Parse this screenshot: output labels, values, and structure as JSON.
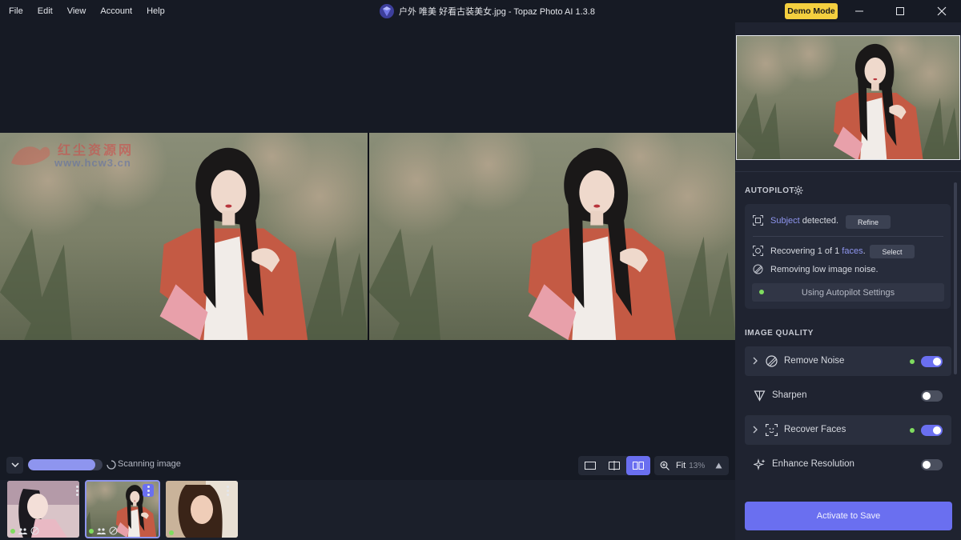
{
  "menu": [
    "File",
    "Edit",
    "View",
    "Account",
    "Help"
  ],
  "window": {
    "title": "户外 唯美 好看古装美女.jpg - Topaz Photo AI 1.3.8",
    "demo_badge": "Demo Mode",
    "controls": [
      "minimize-icon",
      "maximize-icon",
      "close-icon"
    ]
  },
  "watermark": {
    "line1": "红尘资源网",
    "line2": "www.hcw3.cn"
  },
  "bottombar": {
    "progress": 0.9,
    "status": "Scanning image",
    "views": [
      "single-view-icon",
      "split-view-icon",
      "side-by-side-icon"
    ],
    "active_view": 2,
    "zoom_label": "Fit",
    "zoom_value": "13%"
  },
  "thumbnails": {
    "selected": 1,
    "count": 3
  },
  "autopilot": {
    "title": "AUTOPILOT",
    "subject_prefix": "",
    "subject_word": "Subject",
    "subject_suffix": "detected.",
    "refine_label": "Refine",
    "faces_prefix": "Recovering 1 of 1",
    "faces_word": "faces",
    "faces_suffix": ".",
    "select_label": "Select",
    "noise_text": "Removing low image noise.",
    "settings_label": "Using Autopilot Settings"
  },
  "image_quality": {
    "title": "IMAGE QUALITY",
    "items": [
      {
        "label": "Remove Noise",
        "enabled": true,
        "expandable": true,
        "active_dot": true
      },
      {
        "label": "Sharpen",
        "enabled": false,
        "expandable": false,
        "active_dot": false
      },
      {
        "label": "Recover Faces",
        "enabled": true,
        "expandable": true,
        "active_dot": true
      },
      {
        "label": "Enhance Resolution",
        "enabled": false,
        "expandable": false,
        "active_dot": false
      }
    ]
  },
  "activate_label": "Activate to Save",
  "colors": {
    "accent": "#6a6ff0",
    "progress": "#8e95ef",
    "demo": "#f4cf3f",
    "status_green": "#7fdc5f",
    "background": "#161a24",
    "panel": "#1f2330"
  }
}
